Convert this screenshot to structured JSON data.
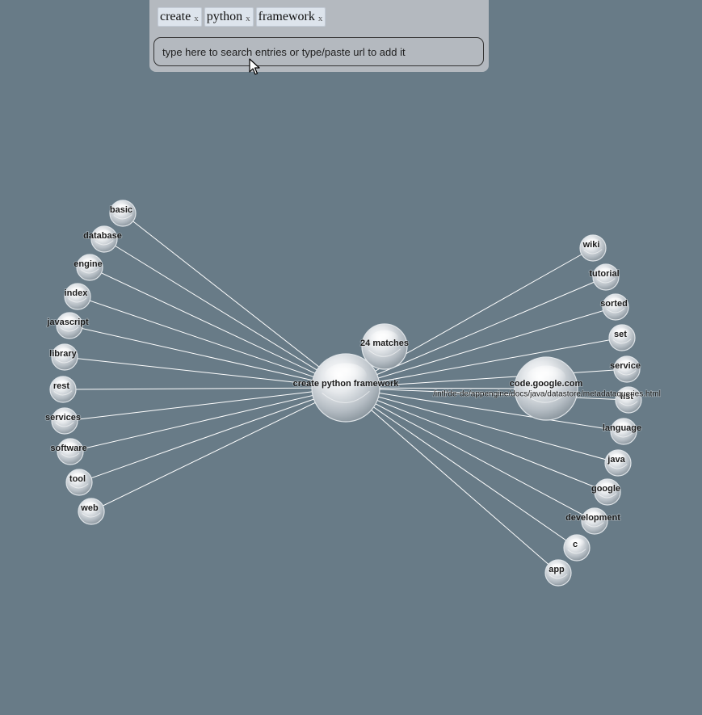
{
  "search": {
    "tags": [
      {
        "label": "create",
        "remove": "x"
      },
      {
        "label": "python",
        "remove": "x"
      },
      {
        "label": "framework",
        "remove": "x"
      }
    ],
    "placeholder": "type here to search entries or type/paste url to add it"
  },
  "graph": {
    "center_label": "create python framework",
    "matches_label": "24 matches",
    "url_node": {
      "domain": "code.google.com",
      "path": "/intl/de-de/appengine/docs/java/datastore/metadataqueries.html"
    },
    "left_nodes": [
      "basic",
      "database",
      "engine",
      "index",
      "javascript",
      "library",
      "rest",
      "services",
      "software",
      "tool",
      "web"
    ],
    "right_nodes": [
      "wiki",
      "tutorial",
      "sorted",
      "set",
      "service",
      "list",
      "language",
      "java",
      "google",
      "development",
      "c",
      "app"
    ]
  },
  "colors": {
    "background": "#687b87",
    "panel": "#b4b9bf",
    "tag": "#dde4ec",
    "edge": "#ffffff"
  },
  "icons": {
    "cursor": "arrow-pointer-icon",
    "node": "glass-sphere-icon"
  }
}
